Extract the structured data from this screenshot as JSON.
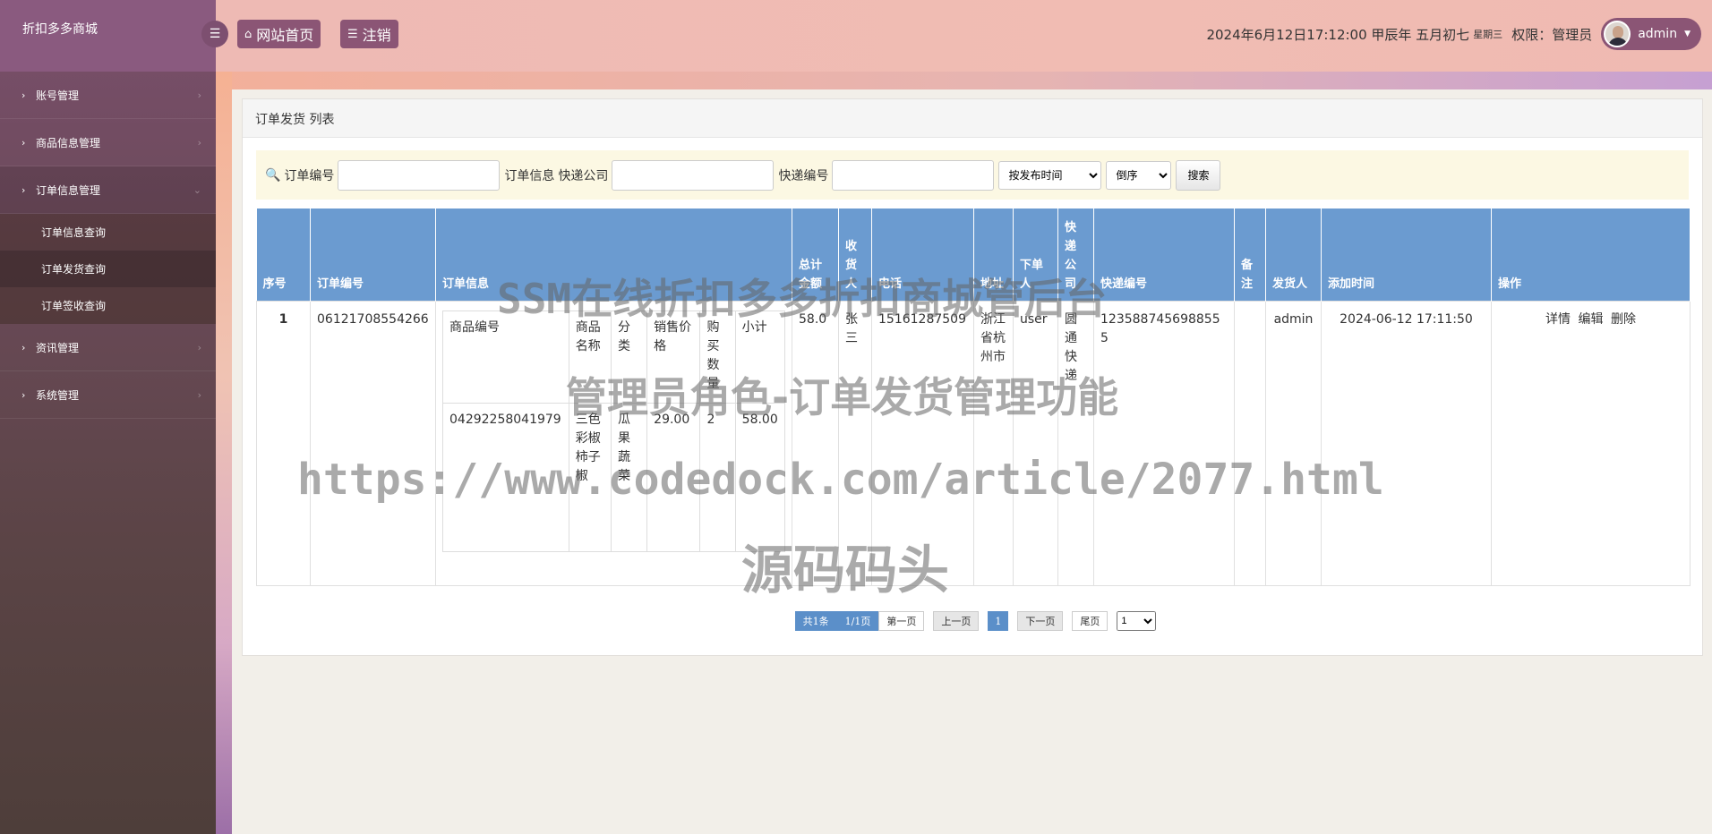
{
  "app": {
    "brand": "折扣多多商城"
  },
  "sidebar": {
    "items": [
      {
        "label": "账号管理"
      },
      {
        "label": "商品信息管理"
      },
      {
        "label": "订单信息管理"
      },
      {
        "label": "资讯管理"
      },
      {
        "label": "系统管理"
      }
    ],
    "sub_items": [
      {
        "label": "订单信息查询"
      },
      {
        "label": "订单发货查询"
      },
      {
        "label": "订单签收查询"
      }
    ]
  },
  "topbar": {
    "home_label": "网站首页",
    "logout_label": "注销",
    "datetime": "2024年6月12日17:12:00 甲辰年 五月初七",
    "weekday": "星期三",
    "role_text": "权限：管理员",
    "username": "admin"
  },
  "panel": {
    "title": "订单发货 列表"
  },
  "search": {
    "label_order_no": "订单编号",
    "label_order_info": "订单信息",
    "label_express_company": "快递公司",
    "label_express_no": "快递编号",
    "sort_field": "按发布时间",
    "sort_order": "倒序",
    "search_label": "搜索"
  },
  "table": {
    "headers": [
      "序号",
      "订单编号",
      "订单信息",
      "总计金额",
      "收货人",
      "电话",
      "地址",
      "下单人",
      "快递公司",
      "快递编号",
      "备注",
      "发货人",
      "添加时间",
      "操作"
    ],
    "inner_headers": [
      "商品编号",
      "商品名称",
      "分类",
      "销售价格",
      "购买数量",
      "小计"
    ],
    "rows": [
      {
        "index": "1",
        "order_no": "06121708554266",
        "items": [
          {
            "product_no": "04292258041979",
            "name": "三色彩椒柿子椒",
            "category": "瓜果蔬菜",
            "price": "29.00",
            "qty": "2",
            "subtotal": "58.00"
          }
        ],
        "total": "58.0",
        "receiver": "张三",
        "phone": "15161287509",
        "address": "浙江省杭州市",
        "buyer": "user",
        "express_company": "圆通快递",
        "express_no": "1235887456988555",
        "remark": "",
        "shipper": "admin",
        "added_time": "2024-06-12 17:11:50",
        "actions": {
          "detail": "详情",
          "edit": "编辑",
          "delete": "删除"
        }
      }
    ]
  },
  "pager": {
    "count": "共1条",
    "pages": "1/1页",
    "first": "第一页",
    "prev": "上一页",
    "current": "1",
    "next": "下一页",
    "last": "尾页",
    "select": "1"
  },
  "watermark": {
    "line1": "SSM在线折扣多多折扣商城管后台",
    "line2": "管理员角色-订单发货管理功能",
    "line3": "https://www.codedock.com/article/2077.html",
    "line4": "源码码头"
  }
}
